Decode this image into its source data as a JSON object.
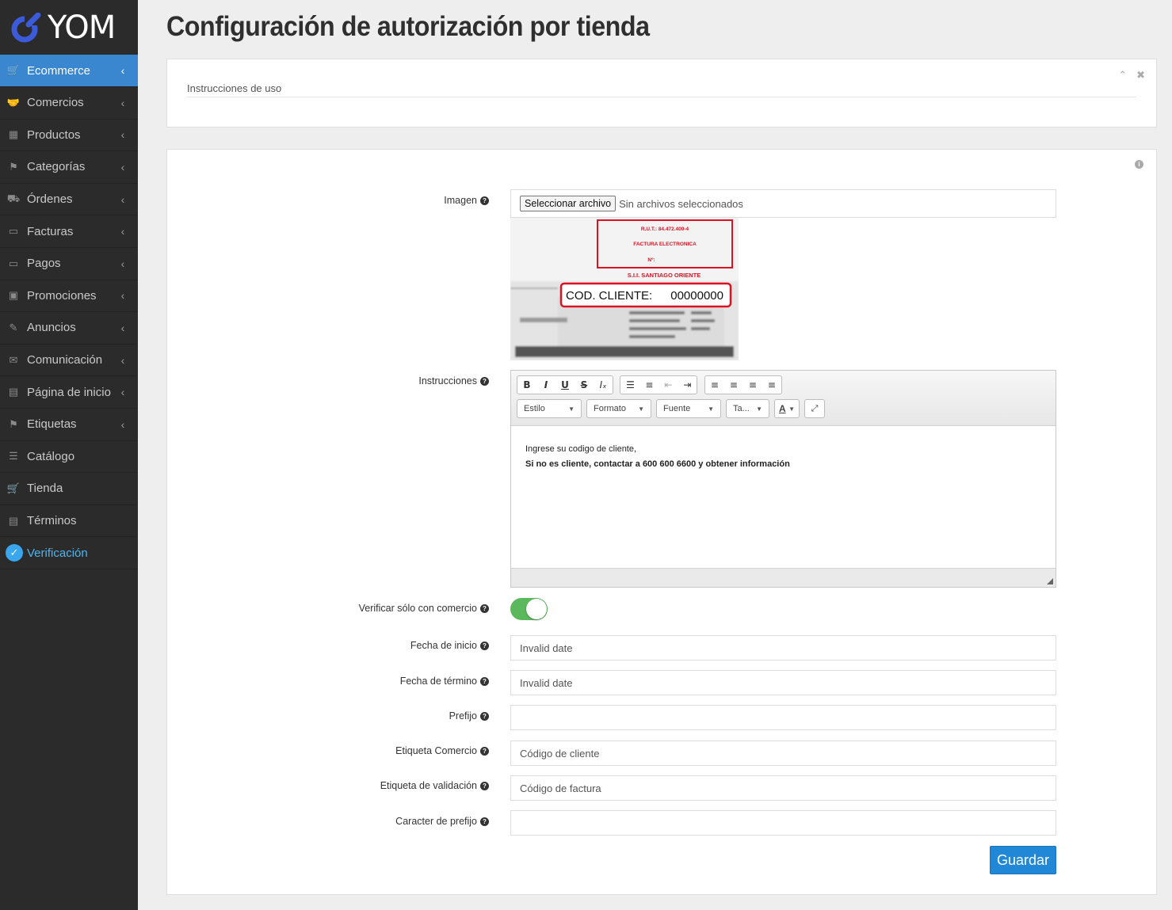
{
  "brand": {
    "name": "YOM",
    "accent": "#3a86cf"
  },
  "sidebar": {
    "items": [
      {
        "label": "Ecommerce",
        "icon": "basket-icon",
        "chevron": true,
        "state": "active"
      },
      {
        "label": "Comercios",
        "icon": "handshake-icon",
        "chevron": true
      },
      {
        "label": "Productos",
        "icon": "table-icon",
        "chevron": true
      },
      {
        "label": "Categorías",
        "icon": "tags-icon",
        "chevron": true
      },
      {
        "label": "Órdenes",
        "icon": "truck-icon",
        "chevron": true
      },
      {
        "label": "Facturas",
        "icon": "credit-card-icon",
        "chevron": true
      },
      {
        "label": "Pagos",
        "icon": "credit-card-icon",
        "chevron": true
      },
      {
        "label": "Promociones",
        "icon": "money-icon",
        "chevron": true
      },
      {
        "label": "Anuncios",
        "icon": "bullhorn-icon",
        "chevron": true
      },
      {
        "label": "Comunicación",
        "icon": "comments-icon",
        "chevron": true
      },
      {
        "label": "Página de inicio",
        "icon": "newspaper-icon",
        "chevron": true
      },
      {
        "label": "Etiquetas",
        "icon": "tag-icon",
        "chevron": true
      },
      {
        "label": "Catálogo",
        "icon": "list-icon",
        "chevron": false
      },
      {
        "label": "Tienda",
        "icon": "cart-icon",
        "chevron": false
      },
      {
        "label": "Términos",
        "icon": "document-icon",
        "chevron": false
      },
      {
        "label": "Verificación",
        "icon": "check-circle-icon",
        "chevron": false,
        "state": "current"
      }
    ]
  },
  "page": {
    "title": "Configuración de autorización por tienda",
    "instructions_panel": {
      "subtitle": "Instrucciones de uso"
    }
  },
  "form": {
    "image": {
      "label": "Imagen",
      "button": "Seleccionar archivo",
      "status": "Sin archivos seleccionados",
      "preview": {
        "rut": "R.U.T.: 84.472.400-4",
        "doc_type": "FACTURA ELECTRONICA",
        "number": "Nº:",
        "office": "S.I.I. SANTIAGO ORIENTE",
        "code_label": "COD. CLIENTE:",
        "code_value": "00000000"
      }
    },
    "instructions": {
      "label": "Instrucciones",
      "toolbar": {
        "style": "Estilo",
        "format": "Formato",
        "font": "Fuente",
        "size": "Ta..."
      },
      "line1": "Ingrese su codigo de cliente,",
      "line2": "Si no es cliente, contactar a 600 600 6600 y obtener información"
    },
    "verify_only_commerce": {
      "label": "Verificar sólo con comercio",
      "on": true
    },
    "start_date": {
      "label": "Fecha de inicio",
      "value": "Invalid date"
    },
    "end_date": {
      "label": "Fecha de término",
      "value": "Invalid date"
    },
    "prefix": {
      "label": "Prefijo",
      "value": ""
    },
    "commerce_label": {
      "label": "Etiqueta Comercio",
      "value": "Código de cliente"
    },
    "validation_label": {
      "label": "Etiqueta de validación",
      "value": "Código de factura"
    },
    "prefix_char": {
      "label": "Caracter de prefijo",
      "value": ""
    },
    "save_label": "Guardar"
  }
}
